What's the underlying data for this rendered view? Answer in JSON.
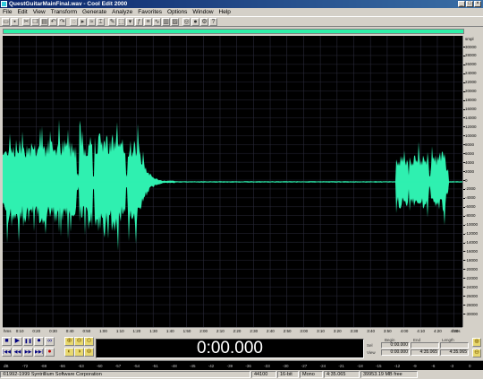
{
  "window": {
    "title": "QuestGuitarMainFinal.wav - Cool Edit 2000",
    "controls": [
      "_",
      "□",
      "×"
    ]
  },
  "menu": [
    "File",
    "Edit",
    "View",
    "Transform",
    "Generate",
    "Analyze",
    "Favorites",
    "Options",
    "Window",
    "Help"
  ],
  "toolbar_icons": [
    "open-icon",
    "save-icon",
    "cut-icon",
    "copy-icon",
    "paste-icon",
    "undo-icon",
    "redo-icon",
    "loop-icon",
    "play-icon",
    "mix-icon",
    "trim-icon",
    "edit-icon",
    "select-icon",
    "marker-icon",
    "fx-icon",
    "eq-icon",
    "filter-icon",
    "meter-icon",
    "noise-icon",
    "cd-icon",
    "record-icon",
    "settings-icon",
    "help-icon"
  ],
  "amplitude_ruler": {
    "unit": "smpl",
    "labels": [
      "30000",
      "28000",
      "26000",
      "24000",
      "22000",
      "20000",
      "18000",
      "16000",
      "14000",
      "12000",
      "10000",
      "8000",
      "6000",
      "4000",
      "2000",
      "0",
      "-2000",
      "-4000",
      "-6000",
      "-8000",
      "-10000",
      "-12000",
      "-14000",
      "-16000",
      "-18000",
      "-20000",
      "-22000",
      "-24000",
      "-26000",
      "-28000",
      "-30000"
    ]
  },
  "time_ruler": {
    "labels": [
      "hms",
      "0:10",
      "0:20",
      "0:30",
      "0:40",
      "0:50",
      "1:00",
      "1:10",
      "1:20",
      "1:30",
      "1:40",
      "1:50",
      "2:00",
      "2:10",
      "2:20",
      "2:30",
      "2:40",
      "2:50",
      "3:00",
      "3:10",
      "3:20",
      "3:30",
      "3:40",
      "3:50",
      "4:00",
      "4:10",
      "4:20",
      "4:30",
      "hms"
    ]
  },
  "transport": {
    "row1": [
      "■",
      "▶",
      "❚❚",
      "⏺",
      "∞"
    ],
    "row2": [
      "|◀◀",
      "◀◀",
      "▶▶",
      "▶▶|",
      "●"
    ]
  },
  "time_display": "0:00.000",
  "selection": {
    "headers": [
      "Begin",
      "End",
      "Length"
    ],
    "rows": [
      {
        "label": "Sel",
        "values": [
          "0:00.000",
          "",
          ""
        ]
      },
      {
        "label": "View",
        "values": [
          "0:00.000",
          "4:35.065",
          "4:35.065"
        ]
      }
    ]
  },
  "level_meter": {
    "labels": [
      "dB",
      "-72",
      "-69",
      "-66",
      "-63",
      "-60",
      "-57",
      "-54",
      "-51",
      "-48",
      "-45",
      "-42",
      "-39",
      "-36",
      "-33",
      "-30",
      "-27",
      "-24",
      "-21",
      "-18",
      "-15",
      "-12",
      "-9",
      "-6",
      "-3",
      "0"
    ]
  },
  "status": {
    "copyright": "©1992-1999 Syntrillium Software Corporation",
    "sample_rate": "44100",
    "bits": "16-bit",
    "channels": "Mono",
    "duration": "4:35.065",
    "free_space": "39953.19 MB free"
  },
  "colors": {
    "waveform": "#2ff0b0",
    "waveform_bg": "#000000",
    "grid": "#2a2a3a",
    "center_line": "#5a5aa0"
  }
}
